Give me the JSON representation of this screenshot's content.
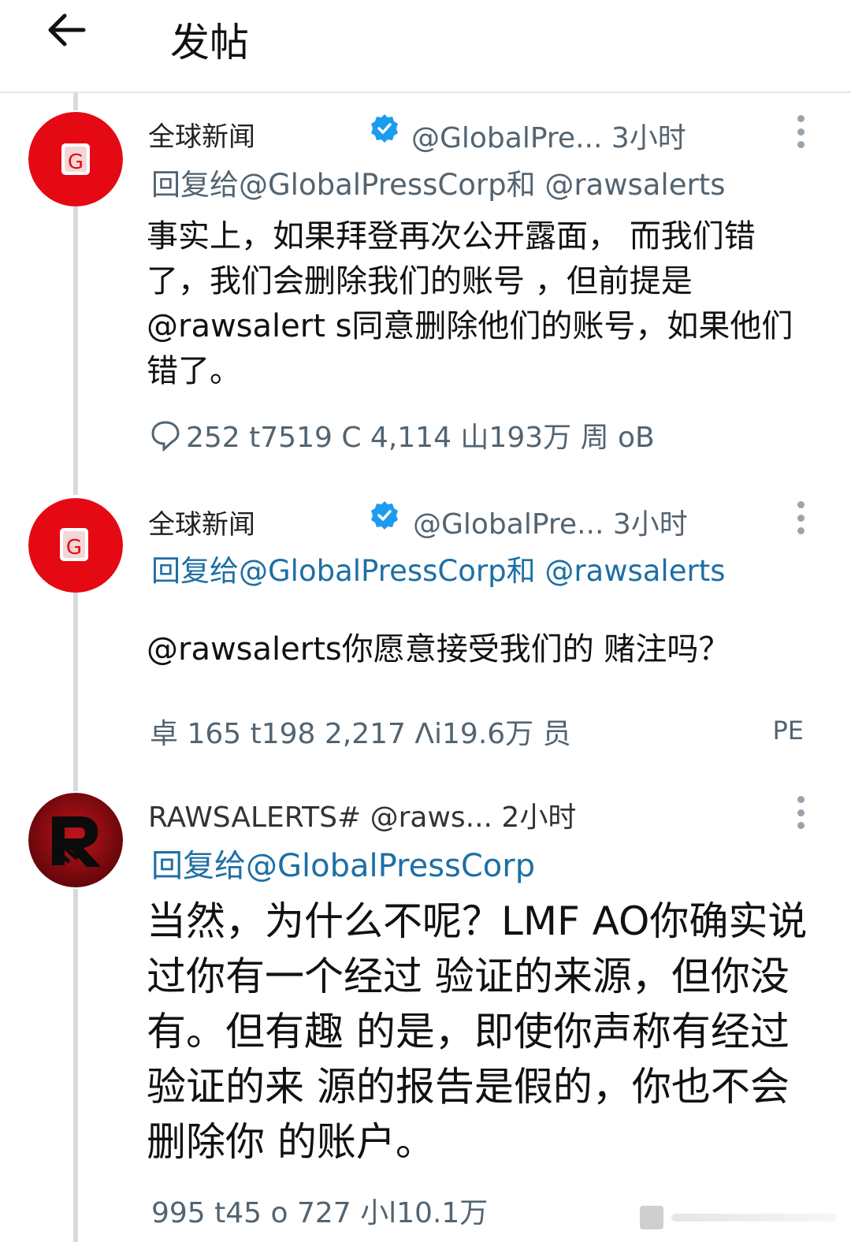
{
  "header": {
    "title": "发帖"
  },
  "tweets": [
    {
      "name": "全球新闻",
      "handle": "@GlobalPre... 3小时",
      "reply_prefix": "回复给",
      "reply_targets": "@GlobalPressCorp和 @rawsalerts",
      "text": "事实上，如果拜登再次公开露面， 而我们错了，我们会删除我们的账号 ，但前提是@rawsalert s同意删除他们的账号，如果他们错了。",
      "stats": "252 t7519 C 4,114 山193万 周 oB"
    },
    {
      "name": "全球新闻",
      "handle": "@GlobalPre... 3小时",
      "reply_prefix": "回复给",
      "reply_targets": "@GlobalPressCorp和 @rawsalerts",
      "text": "@rawsalerts你愿意接受我们的 赌注吗？",
      "stats": "卓 165 t198 2,217 Λi19.6万 员",
      "extra": "PE"
    },
    {
      "name": "RAWSALERTS# @raws... 2小时",
      "reply_prefix": "回复给",
      "reply_targets": "@GlobalPressCorp",
      "text": "当然，为什么不呢？LMF AO你确实说过你有一个经过 验证的来源，但你没有。但有趣 的是，即使你声称有经过验证的来 源的报告是假的，你也不会删除你 的账户。",
      "stats": "995 t45 o 727 小l10.1万"
    }
  ],
  "colors": {
    "avatar_red": "#e50914",
    "link": "#1d6fa5",
    "muted": "#536471",
    "verified": "#1d9bf0"
  }
}
